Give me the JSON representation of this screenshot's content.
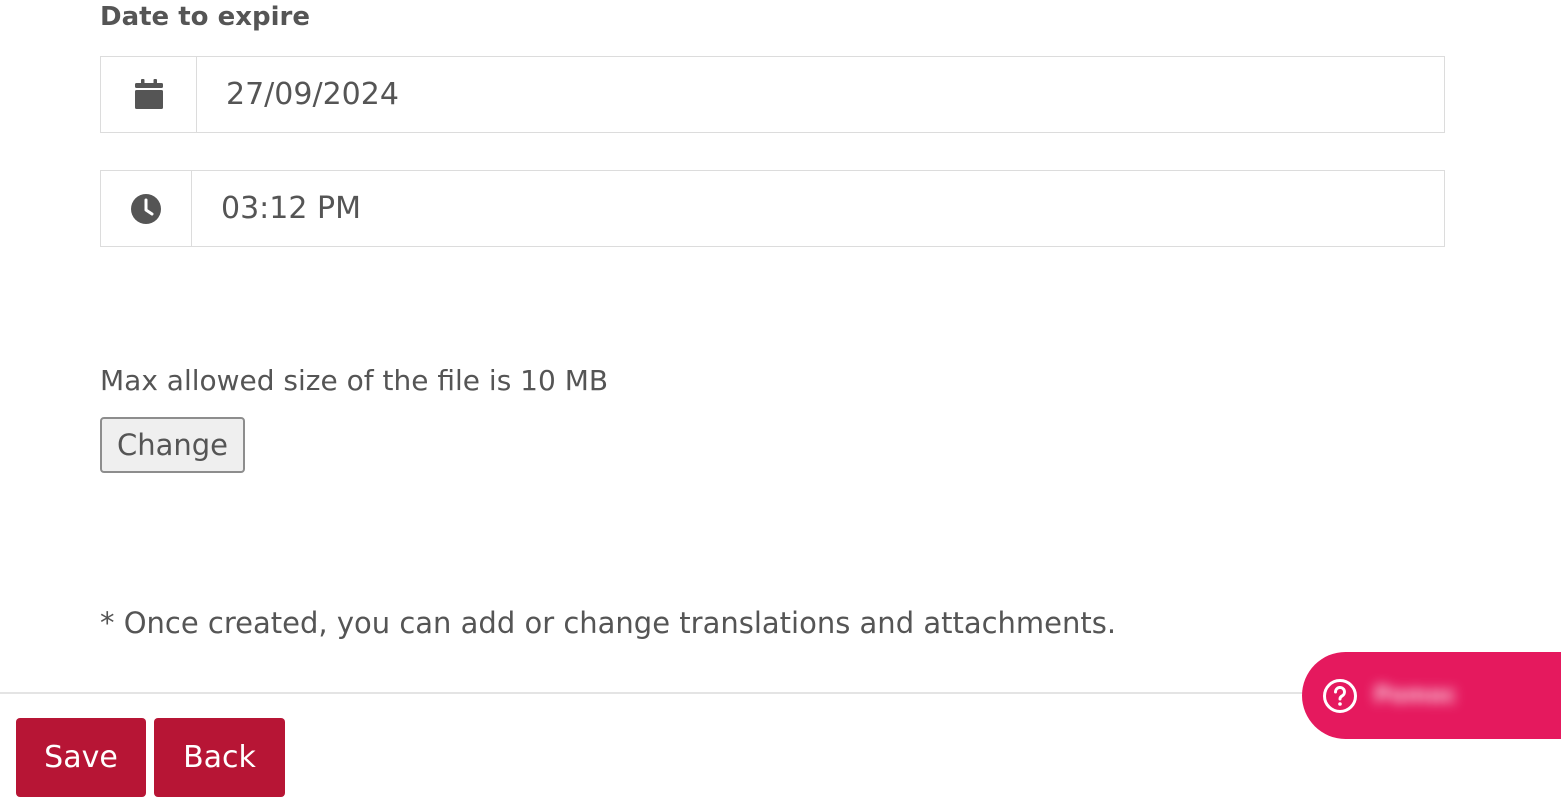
{
  "expiry": {
    "label": "Date to expire",
    "date_value": "27/09/2024",
    "time_value": "03:12 PM"
  },
  "upload": {
    "note": "Max allowed size of the file is 10 MB",
    "change_label": "Change"
  },
  "footnote": "* Once created, you can add or change translations and attachments.",
  "actions": {
    "save_label": "Save",
    "back_label": "Back"
  },
  "help_widget": {
    "label": "Pomoc",
    "icon": "question-circle-icon"
  },
  "colors": {
    "primary_button": "#b71535",
    "help_widget": "#e5195e",
    "text": "#555555",
    "border": "#dcdcdc"
  }
}
